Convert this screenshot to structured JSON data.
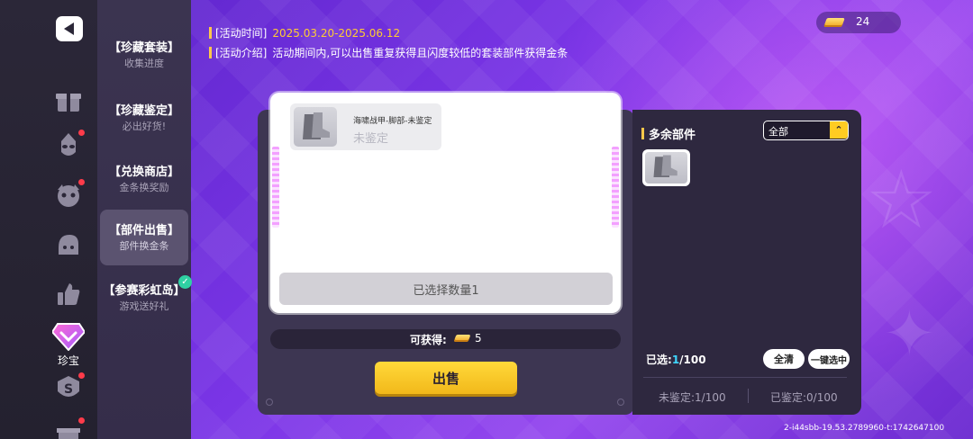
{
  "rail": {
    "gem_label": "珍宝"
  },
  "menu": {
    "items": [
      {
        "title": "【珍藏套装】",
        "sub": "收集进度"
      },
      {
        "title": "【珍藏鉴定】",
        "sub": "必出好货!"
      },
      {
        "title": "【兑换商店】",
        "sub": "金条换奖励"
      },
      {
        "title": "【部件出售】",
        "sub": "部件换金条"
      },
      {
        "title": "【参赛彩虹岛】",
        "sub": "游戏送好礼"
      }
    ]
  },
  "header": {
    "time_key": "[活动时间]",
    "time_value": "2025.03.20-2025.06.12",
    "intro_key": "[活动介绍]",
    "intro_value": "活动期间内,可以出售重复获得且闪度较低的套装部件获得金条"
  },
  "currency": {
    "gold_count": "24"
  },
  "sell_card": {
    "item_name": "海啸战甲-脚部-未鉴定",
    "item_state": "未鉴定",
    "selected_label": "已选择数量1",
    "obtain_label": "可获得:",
    "obtain_value": "5",
    "sell_button": "出售"
  },
  "inventory": {
    "title": "多余部件",
    "filter_value": "全部",
    "selected_prefix": "已选:",
    "selected_current": "1",
    "selected_total": "/100",
    "clear_button": "全清",
    "select_all_button": "一键选中",
    "unappraised": "未鉴定:1/100",
    "appraised": "已鉴定:0/100"
  },
  "build_info": "2-i44sbb-19.53.2789960-t:1742647100",
  "colors": {
    "accent_gold": "#ffcc33",
    "sell_button": "#f2b81a",
    "highlight_blue": "#3fd7ff",
    "notify_red": "#ff3b4a"
  }
}
